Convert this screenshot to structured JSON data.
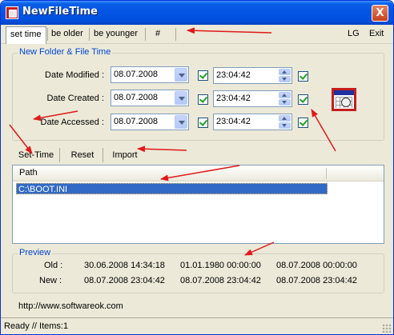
{
  "window": {
    "title": "NewFileTime",
    "close_glyph": "X"
  },
  "menu": {
    "items": [
      "set time",
      "be older",
      "be younger",
      "#"
    ],
    "right_items": [
      "LG",
      "Exit"
    ]
  },
  "group": {
    "title": "New Folder & File Time",
    "rows": [
      {
        "label": "Date Modified :",
        "date": "08.07.2008",
        "time": "23:04:42"
      },
      {
        "label": "Date Created :",
        "date": "08.07.2008",
        "time": "23:04:42"
      },
      {
        "label": "Date Accessed :",
        "date": "08.07.2008",
        "time": "23:04:42"
      }
    ]
  },
  "actions": [
    "Set-Time",
    "Reset",
    "Import"
  ],
  "list": {
    "column": "Path",
    "rows": [
      "C:\\BOOT.INI"
    ]
  },
  "preview": {
    "title": "Preview",
    "old_label": "Old :",
    "new_label": "New :",
    "old": [
      "30.06.2008 14:34:18",
      "01.01.1980 00:00:00",
      "08.07.2008 00:00:00"
    ],
    "new": [
      "08.07.2008 23:04:42",
      "08.07.2008 23:04:42",
      "08.07.2008 23:04:42"
    ]
  },
  "url": "http://www.softwareok.com",
  "status": "Ready // Items:1",
  "icons": [
    "app-icon",
    "close-icon",
    "dropdown-icon",
    "spinner-icon",
    "checkbox-icon",
    "calendar-clock-icon",
    "size-grip-icon"
  ],
  "colors": {
    "titlebar": "#0554e3",
    "group_title": "#0046d5",
    "selection": "#316ac5",
    "annotation_arrow": "#e0191b"
  }
}
